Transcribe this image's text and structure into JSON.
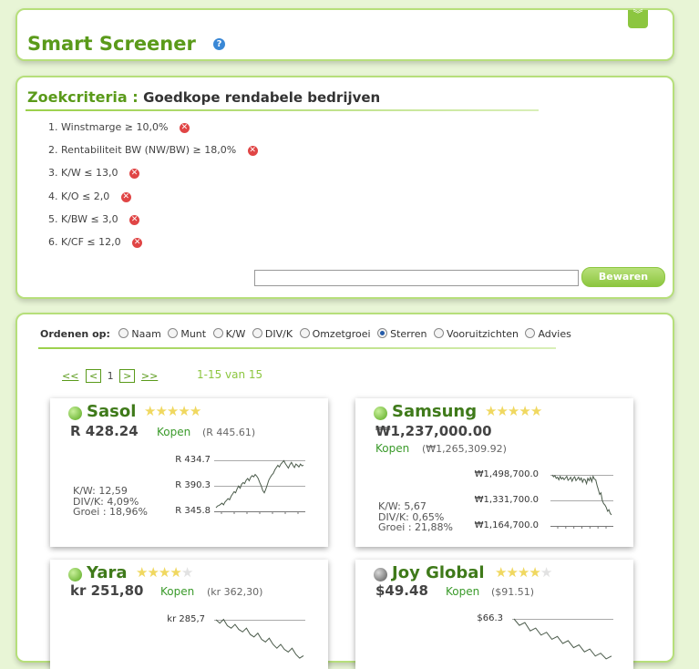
{
  "header": {
    "title": "Smart Screener",
    "help_glyph": "?",
    "collapse_glyph": "︾"
  },
  "criteria": {
    "label": "Zoekcriteria :",
    "name": "Goedkope rendabele bedrijven",
    "items": [
      {
        "num": "1.",
        "text": "Winstmarge ≥ 10,0%"
      },
      {
        "num": "2.",
        "text": "Rentabiliteit BW (NW/BW) ≥ 18,0%"
      },
      {
        "num": "3.",
        "text": "K/W ≤ 13,0"
      },
      {
        "num": "4.",
        "text": "K/O ≤ 2,0"
      },
      {
        "num": "5.",
        "text": "K/BW ≤ 3,0"
      },
      {
        "num": "6.",
        "text": "K/CF ≤ 12,0"
      }
    ],
    "delete_glyph": "✕",
    "save_input_value": "",
    "save_label": "Bewaren"
  },
  "results": {
    "sort_label": "Ordenen op:",
    "sort_options": [
      "Naam",
      "Munt",
      "K/W",
      "DIV/K",
      "Omzetgroei",
      "Sterren",
      "Vooruitzichten",
      "Advies"
    ],
    "sort_selected": "Sterren",
    "pager": {
      "first": "<<",
      "prev": "<",
      "page": "1",
      "next": ">",
      "last": ">>"
    },
    "count_text": "1-15 van 15",
    "cards": [
      {
        "name": "Sasol",
        "status": "green",
        "stars": 5,
        "stars_max": 5,
        "price": "R 428.24",
        "advice": "Kopen",
        "target": "(R 445.61)",
        "stats": [
          "K/W: 12,59",
          "DIV/K: 4,09%",
          "Groei : 18,96%"
        ],
        "chart": {
          "type": "line",
          "yticks": [
            "R 434.7",
            "R 390.3",
            "R 345.8"
          ],
          "ylim": [
            345.8,
            434.7
          ],
          "values": [
            352,
            355,
            356,
            358,
            360,
            357,
            362,
            365,
            368,
            366,
            372,
            376,
            380,
            378,
            385,
            390,
            386,
            393,
            396,
            394,
            400,
            403,
            399,
            405,
            408,
            406,
            410,
            407,
            403,
            396,
            390,
            382,
            378,
            384,
            392,
            400,
            405,
            409,
            412,
            418,
            422,
            426,
            423,
            428,
            431,
            434,
            429,
            425,
            421,
            427,
            431,
            426,
            422,
            428,
            426,
            423,
            428,
            425,
            426
          ]
        }
      },
      {
        "name": "Samsung",
        "status": "green",
        "stars": 5,
        "stars_max": 5,
        "price": "₩1,237,000.00",
        "advice": "Kopen",
        "target": "(₩1,265,309.92)",
        "stats": [
          "K/W: 5,67",
          "DIV/K: 0,65%",
          "Groei : 21,88%"
        ],
        "chart": {
          "type": "line",
          "yticks": [
            "₩1,498,700.0",
            "₩1,331,700.0",
            "₩1,164,700.0"
          ],
          "ylim": [
            1164700,
            1498700
          ],
          "values": [
            1498700,
            1486000,
            1494000,
            1476000,
            1484000,
            1466000,
            1489000,
            1471000,
            1481000,
            1467000,
            1478000,
            1489000,
            1463000,
            1471000,
            1483000,
            1457000,
            1476000,
            1486000,
            1461000,
            1471000,
            1484000,
            1464000,
            1479000,
            1451000,
            1471000,
            1466000,
            1441000,
            1476000,
            1461000,
            1483000,
            1454000,
            1489000,
            1471000,
            1466000,
            1431000,
            1401000,
            1371000,
            1381000,
            1331000,
            1311000,
            1301000,
            1286000,
            1261000,
            1271000,
            1246000,
            1237000
          ]
        }
      },
      {
        "name": "Yara",
        "status": "green",
        "stars": 4,
        "stars_max": 5,
        "price": "kr 251,80",
        "advice": "Kopen",
        "target": "(kr 362,30)",
        "stats": [],
        "chart": {
          "type": "line",
          "yticks": [
            "kr 285,7"
          ],
          "ylim": [
            250,
            285.7
          ],
          "values": [
            285.7,
            283,
            286,
            281,
            279,
            282,
            278,
            276,
            279,
            274,
            272,
            275,
            270,
            268,
            271,
            266,
            263,
            266,
            262,
            260,
            263,
            258,
            255,
            257
          ]
        }
      },
      {
        "name": "Joy Global",
        "status": "grey",
        "stars": 4,
        "stars_max": 5,
        "price": "$49.48",
        "advice": "Kopen",
        "target": "($91.51)",
        "stats": [],
        "chart": {
          "type": "line",
          "yticks": [
            "$66.3"
          ],
          "ylim": [
            50,
            66.3
          ],
          "values": [
            66.3,
            64,
            65,
            62,
            63,
            60.5,
            61.5,
            59,
            60,
            57.5,
            58.5,
            56,
            57,
            54.5,
            55.5,
            53,
            54,
            52,
            53
          ]
        }
      }
    ]
  }
}
